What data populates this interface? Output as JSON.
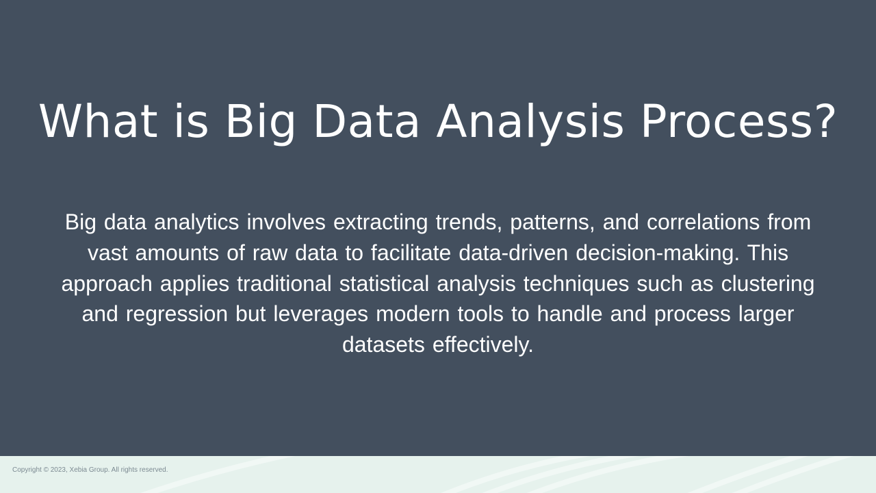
{
  "slide": {
    "title": "What is Big Data Analysis Process?",
    "body": "Big data analytics involves extracting trends, patterns, and correlations from vast amounts of raw data to facilitate data-driven decision-making. This approach applies traditional statistical analysis techniques such as clustering and regression but leverages modern tools to handle and process larger datasets effectively."
  },
  "footer": {
    "copyright": "Copyright © 2023, Xebia Group. All rights reserved."
  },
  "colors": {
    "background": "#434f5e",
    "text": "#ffffff",
    "footer_band": "#e6f2ed",
    "footer_text": "#7c8a92"
  }
}
